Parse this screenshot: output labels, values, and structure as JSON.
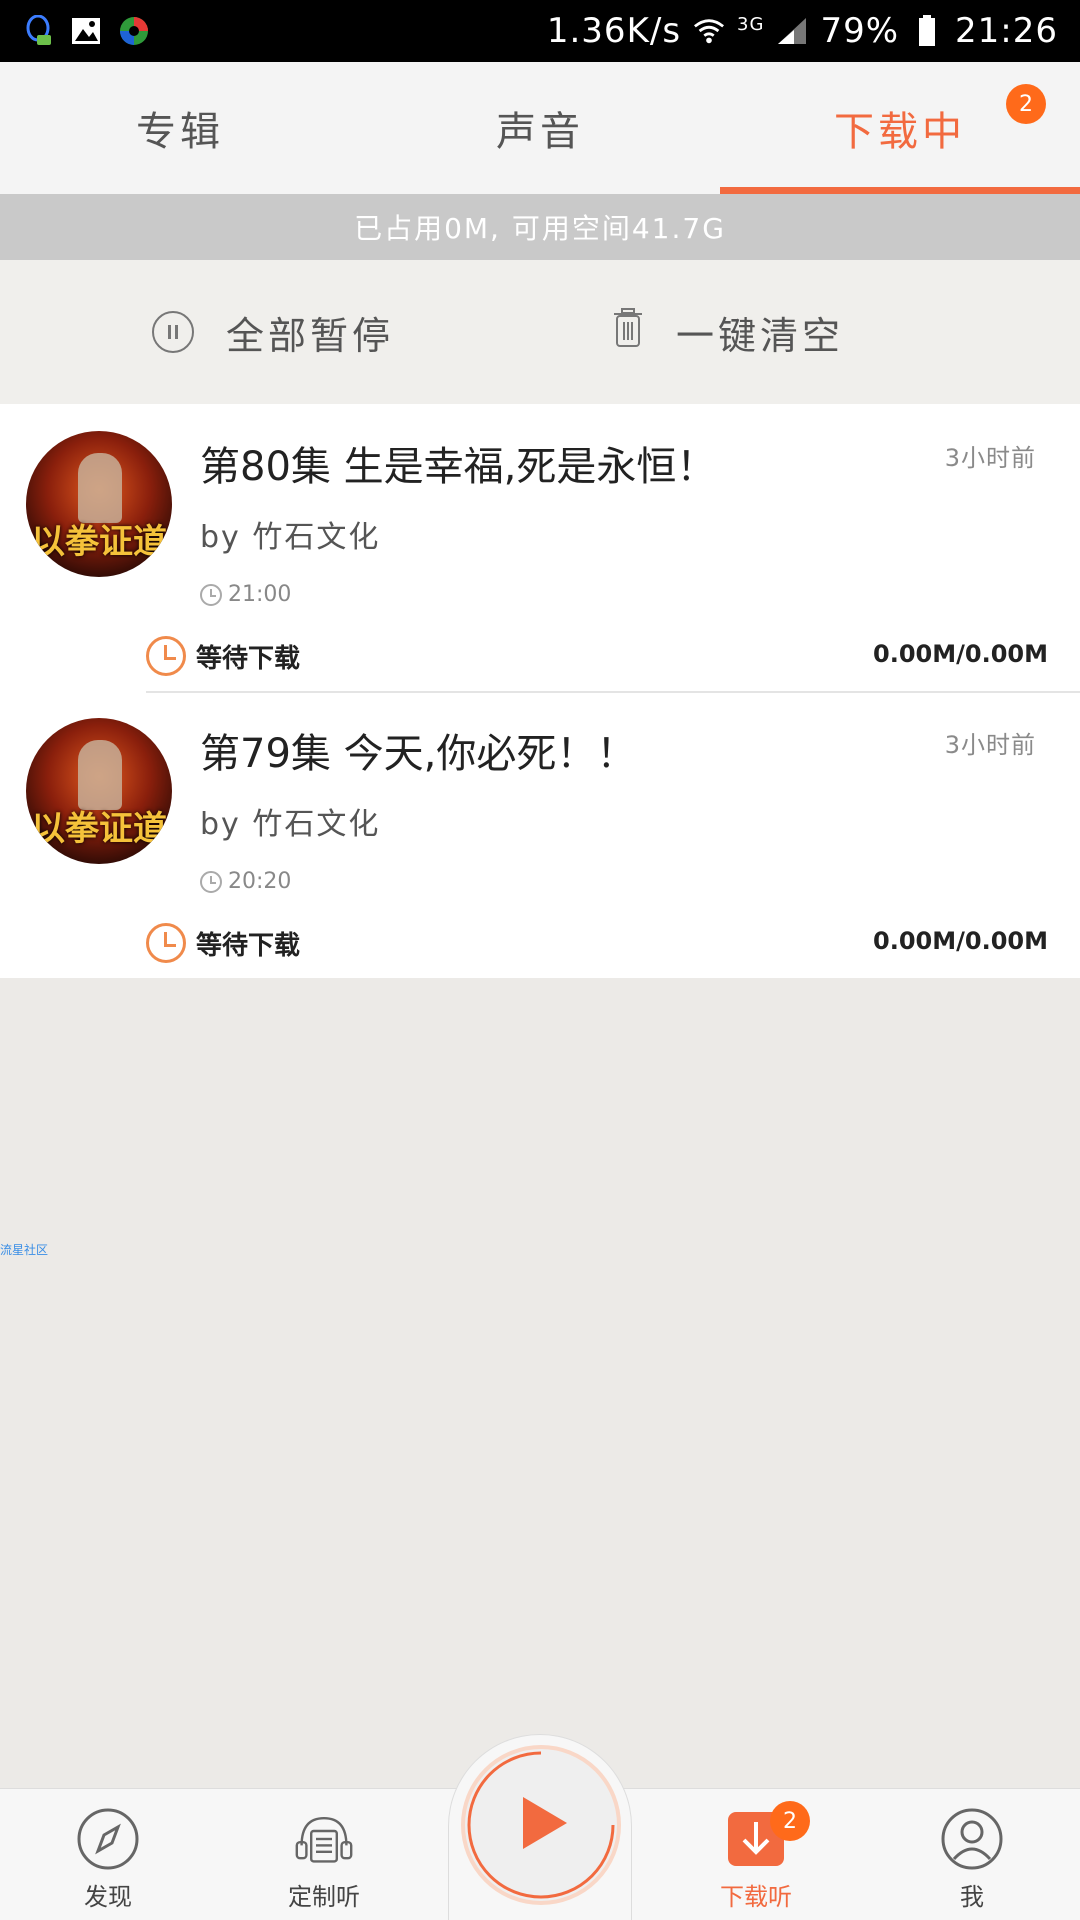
{
  "status_bar": {
    "speed": "1.36K/s",
    "network": "3G",
    "battery": "79%",
    "time": "21:26"
  },
  "tabs": [
    {
      "label": "专辑"
    },
    {
      "label": "声音"
    },
    {
      "label": "下载中",
      "badge": "2"
    }
  ],
  "storage_text": "已占用0M, 可用空间41.7G",
  "actions": {
    "pause_all": "全部暂停",
    "clear_all": "一键清空"
  },
  "downloads": [
    {
      "title": "第80集 生是幸福,死是永恒！",
      "author": "by 竹石文化",
      "duration": "21:00",
      "time_ago": "3小时前",
      "status": "等待下载",
      "size": "0.00M/0.00M",
      "cover_text": "以拳证道"
    },
    {
      "title": "第79集 今天,你必死！！",
      "author": "by 竹石文化",
      "duration": "20:20",
      "time_ago": "3小时前",
      "status": "等待下载",
      "size": "0.00M/0.00M",
      "cover_text": "以拳证道"
    }
  ],
  "watermark": "流星社区",
  "bottom_nav": {
    "discover": "发现",
    "custom_listen": "定制听",
    "download_listen": "下载听",
    "download_badge": "2",
    "me": "我"
  },
  "colors": {
    "accent": "#f26a3f",
    "badge": "#ff6a1a"
  }
}
